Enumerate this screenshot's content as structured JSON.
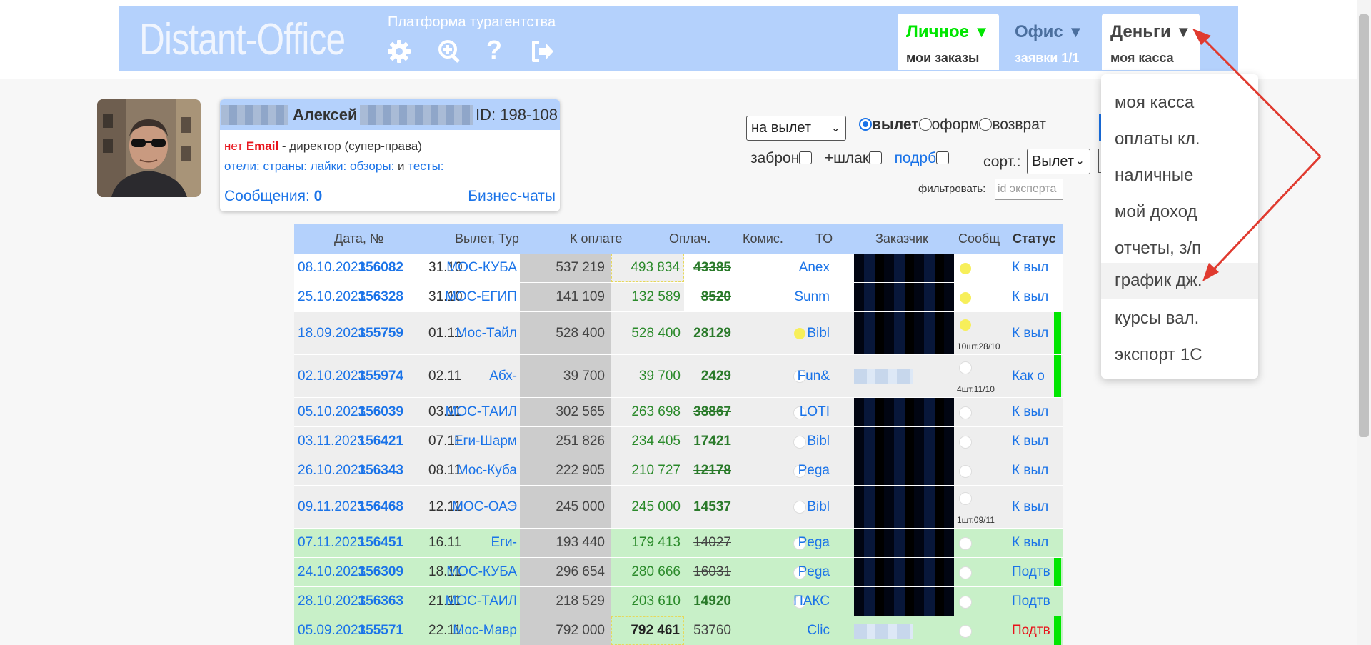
{
  "header": {
    "logo": "Distant-Office",
    "subtitle": "Платформа турагентства",
    "icons": [
      "gear-icon",
      "zoom-icon",
      "help-icon",
      "logout-icon"
    ],
    "help_glyph": "?",
    "tabs": [
      {
        "title": "Личное",
        "sub": "мои заказы",
        "color": "#00e600"
      },
      {
        "title": "Офис",
        "sub": "заявки 1/1",
        "color": "#4b6f9e"
      },
      {
        "title": "Деньги",
        "sub": "моя касса",
        "color": "#444"
      }
    ],
    "triangle": "▼"
  },
  "money_menu": {
    "items": [
      "моя касса",
      "оплаты кл.",
      "наличные",
      "мой доход",
      "отчеты, з/п",
      "график дж.",
      "курсы вал.",
      "экспорт 1С"
    ]
  },
  "user": {
    "name": "Алексей",
    "id": "ID: 198-108",
    "no": "нет",
    "email": "Email",
    "role": " - директор (супер-права)",
    "links": [
      "отели:",
      "страны:",
      "лайки:",
      "обзоры:"
    ],
    "and": "и",
    "tests": "тесты:",
    "messages_label": "Сообщения:",
    "messages_count": "0",
    "chats": "Бизнес-чаты"
  },
  "filters": {
    "date_select": "на вылет",
    "radios": [
      "вылет",
      "оформ",
      "возврат"
    ],
    "checks": [
      "заброн",
      "+шлак",
      "подрб"
    ],
    "sort_label": "сорт.:",
    "sort_value": "Вылет",
    "filter_label": "фильтровать:",
    "filter_placeholder": "id эксперта"
  },
  "table": {
    "headers": [
      "Дата, №",
      "Вылет, Тур",
      "К оплате",
      "Оплач.",
      "Комис.",
      "ТО",
      "Заказчик",
      "Сообщ",
      "Статус"
    ],
    "rows": [
      {
        "date": "08.10.2023",
        "num": "156082",
        "dep": "31.10",
        "tour": "МОС-КУБА",
        "topay": "537 219",
        "paid": "493 834",
        "com": "43385",
        "to": "Anex",
        "status": "К выл",
        "bg": "#ffffff",
        "strike": true,
        "comBold": true,
        "comGreen": true,
        "paidDash": true,
        "dot1": false,
        "dot2": "y",
        "note": "",
        "bar": false,
        "custLight": false,
        "statusRed": false
      },
      {
        "date": "25.10.2023",
        "num": "156328",
        "dep": "31.10",
        "tour": "МОС-ЕГИП",
        "topay": "141 109",
        "paid": "132 589",
        "com": "8520",
        "to": "Sunm",
        "status": "К выл",
        "bg": "#ffffff",
        "strike": true,
        "comBold": true,
        "comGreen": true,
        "paidDash": false,
        "dot1": false,
        "dot2": "y",
        "note": "",
        "bar": false,
        "custLight": false,
        "statusRed": false
      },
      {
        "date": "18.09.2023",
        "num": "155759",
        "dep": "01.11",
        "tour": "Мос-Тайл",
        "topay": "528 400",
        "paid": "528 400",
        "com": "28129",
        "to": "Bibl",
        "status": "К выл",
        "bg": "#eeeeee",
        "strike": false,
        "comBold": true,
        "comGreen": true,
        "paidDash": false,
        "dot1": "y",
        "dot2": "y",
        "note": "10шт.28/10",
        "bar": true,
        "custLight": false,
        "statusRed": false
      },
      {
        "date": "02.10.2023",
        "num": "155974",
        "dep": "02.11",
        "tour": "Абх-",
        "topay": "39 700",
        "paid": "39 700",
        "com": "2429",
        "to": "Fun&",
        "status": "Как о",
        "bg": "#eeeeee",
        "strike": false,
        "comBold": true,
        "comGreen": true,
        "paidDash": false,
        "dot1": "w",
        "dot2": "w",
        "note": "4шт.11/10",
        "bar": true,
        "custLight": true,
        "statusRed": false
      },
      {
        "date": "05.10.2023",
        "num": "156039",
        "dep": "03.11",
        "tour": "МОС-ТАИЛ",
        "topay": "302 565",
        "paid": "263 698",
        "com": "38867",
        "to": "LOTI",
        "status": "К выл",
        "bg": "#eeeeee",
        "strike": true,
        "comBold": true,
        "comGreen": true,
        "paidDash": false,
        "dot1": "w",
        "dot2": "w",
        "note": "",
        "bar": false,
        "custLight": false,
        "statusRed": false
      },
      {
        "date": "03.11.2023",
        "num": "156421",
        "dep": "07.11",
        "tour": "Еги-Шарм",
        "topay": "251 826",
        "paid": "234 405",
        "com": "17421",
        "to": "Bibl",
        "status": "К выл",
        "bg": "#eeeeee",
        "strike": true,
        "comBold": true,
        "comGreen": true,
        "paidDash": false,
        "dot1": "w",
        "dot2": "w",
        "note": "",
        "bar": false,
        "custLight": false,
        "statusRed": false
      },
      {
        "date": "26.10.2023",
        "num": "156343",
        "dep": "08.11",
        "tour": "Мос-Куба",
        "topay": "222 905",
        "paid": "210 727",
        "com": "12178",
        "to": "Pega",
        "status": "К выл",
        "bg": "#eeeeee",
        "strike": true,
        "comBold": true,
        "comGreen": true,
        "paidDash": false,
        "dot1": "w",
        "dot2": "w",
        "note": "",
        "bar": false,
        "custLight": false,
        "statusRed": false
      },
      {
        "date": "09.11.2023",
        "num": "156468",
        "dep": "12.11",
        "tour": "МОС-ОАЭ",
        "topay": "245 000",
        "paid": "245 000",
        "com": "14537",
        "to": "Bibl",
        "status": "К выл",
        "bg": "#eeeeee",
        "strike": false,
        "comBold": true,
        "comGreen": true,
        "paidDash": false,
        "dot1": "w",
        "dot2": "w",
        "note": "1шт.09/11",
        "bar": false,
        "custLight": false,
        "statusRed": false
      },
      {
        "date": "07.11.2023",
        "num": "156451",
        "dep": "16.11",
        "tour": "Еги-",
        "topay": "193 440",
        "paid": "179 413",
        "com": "14027",
        "to": "Pega",
        "status": "К выл",
        "bg": "#c8f0c8",
        "strike": true,
        "comBold": false,
        "comGreen": false,
        "paidDash": false,
        "dot1": "w",
        "dot2": "w",
        "note": "",
        "bar": false,
        "custLight": false,
        "statusRed": false
      },
      {
        "date": "24.10.2023",
        "num": "156309",
        "dep": "18.11",
        "tour": "МОС-КУБА",
        "topay": "296 654",
        "paid": "280 666",
        "com": "16031",
        "to": "Pega",
        "status": "Подтв",
        "bg": "#c8f0c8",
        "strike": true,
        "comBold": false,
        "comGreen": false,
        "paidDash": false,
        "dot1": "w",
        "dot2": "w",
        "note": "",
        "bar": true,
        "custLight": false,
        "statusRed": false
      },
      {
        "date": "28.10.2023",
        "num": "156363",
        "dep": "21.11",
        "tour": "МОС-ТАИЛ",
        "topay": "218 529",
        "paid": "203 610",
        "com": "14920",
        "to": "ПАКС",
        "status": "Подтв",
        "bg": "#c8f0c8",
        "strike": true,
        "comBold": true,
        "comGreen": true,
        "paidDash": false,
        "dot1": "w",
        "dot2": "w",
        "note": "",
        "bar": false,
        "custLight": false,
        "statusRed": false
      },
      {
        "date": "05.09.2023",
        "num": "155571",
        "dep": "22.11",
        "tour": "Мос-Мавр",
        "topay": "792 000",
        "paid": "792 461",
        "com": "53760",
        "to": "Clic",
        "status": "Подтв",
        "bg": "#c8f0c8",
        "strike": false,
        "comBold": false,
        "comGreen": false,
        "paidDash": true,
        "dot1": false,
        "dot2": "w",
        "note": "",
        "bar": true,
        "custLight": true,
        "statusRed": true
      }
    ]
  }
}
